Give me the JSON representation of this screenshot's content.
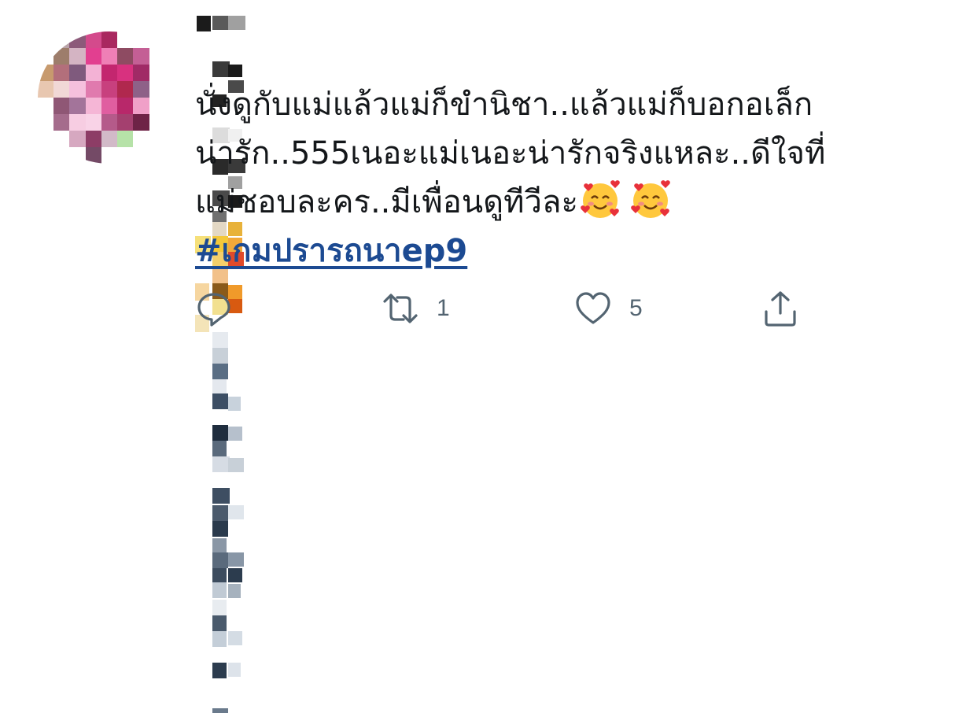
{
  "tweet": {
    "text_lines": [
      "นั่งดูกับแม่แล้วแม่ก็ขำนิชา..แล้วแม่ก็บอกอเล็ก",
      "น่ารัก..555เนอะแม่เนอะน่ารักจริงแหละ..ดีใจที่",
      "แม่ชอบละคร..มีเพื่อนดูทีวีละ"
    ],
    "emoji": [
      "smiling-face-with-hearts",
      "smiling-face-with-hearts"
    ],
    "hashtag": "#เกมปรารถนาep9"
  },
  "actions": {
    "reply": {
      "icon": "reply-icon"
    },
    "retweet": {
      "icon": "retweet-icon",
      "count": "1"
    },
    "like": {
      "icon": "heart-icon",
      "count": "5"
    },
    "share": {
      "icon": "share-icon"
    }
  },
  "colors": {
    "text": "#14171a",
    "hashtag": "#1c4a92",
    "icon": "#536471"
  }
}
